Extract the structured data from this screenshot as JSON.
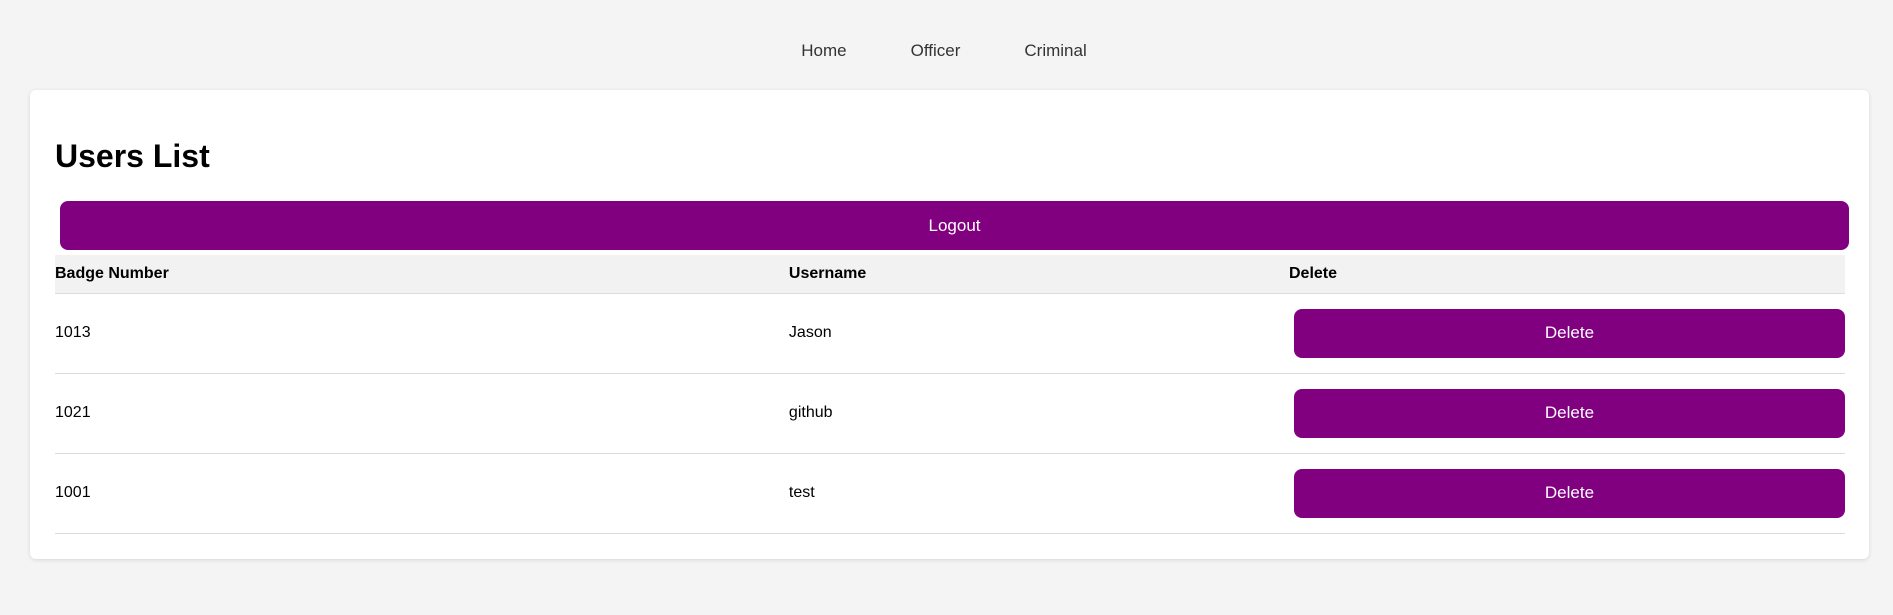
{
  "nav": {
    "items": [
      {
        "label": "Home"
      },
      {
        "label": "Officer"
      },
      {
        "label": "Criminal"
      }
    ]
  },
  "page": {
    "title": "Users List",
    "logout_label": "Logout"
  },
  "table": {
    "headers": [
      "Badge Number",
      "Username",
      "Delete"
    ],
    "rows": [
      {
        "badge": "1013",
        "username": "Jason",
        "action": "Delete"
      },
      {
        "badge": "1021",
        "username": "github",
        "action": "Delete"
      },
      {
        "badge": "1001",
        "username": "test",
        "action": "Delete"
      }
    ]
  },
  "colors": {
    "accent": "#800080",
    "background": "#f4f4f4",
    "card": "#ffffff",
    "header_row": "#f2f2f2"
  }
}
